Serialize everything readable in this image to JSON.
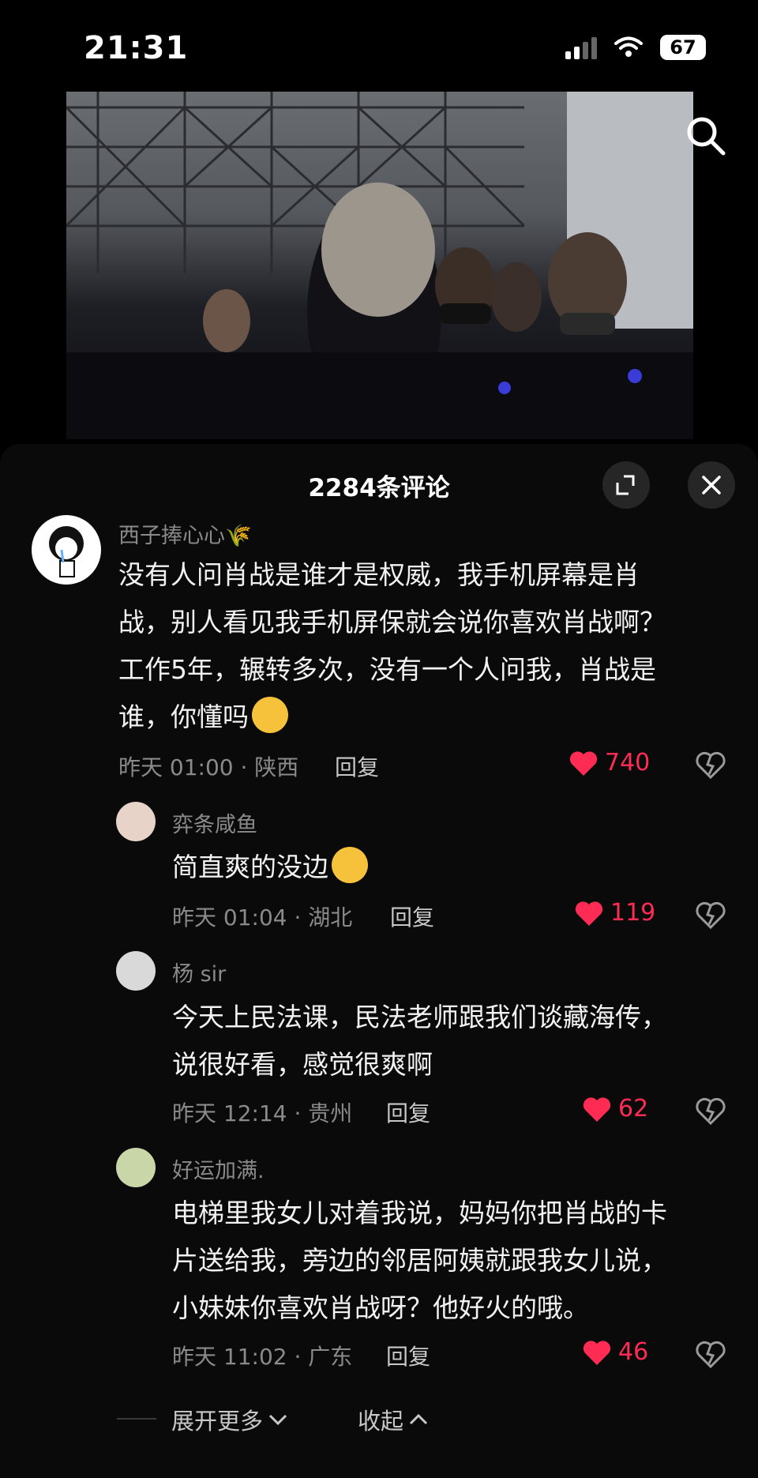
{
  "status_bar": {
    "time": "21:31",
    "battery": "67"
  },
  "comments_header": {
    "title": "2284条评论"
  },
  "comments": [
    {
      "username": "西子捧心心🌾",
      "text_lines": [
        "没有人问肖战是谁才是权威，我手机屏幕是肖",
        "战，别人看见我手机屏保就会说你喜欢肖战啊？",
        "工作5年，辗转多次，没有一个人问我，肖战是",
        "谁，你懂吗"
      ],
      "meta": "昨天 01:00 · 陕西",
      "reply_label": "回复",
      "likes": "740"
    },
    {
      "username": "弈条咸鱼",
      "text_lines": [
        "简直爽的没边"
      ],
      "meta": "昨天 01:04 · 湖北",
      "reply_label": "回复",
      "likes": "119"
    },
    {
      "username": "杨 sir",
      "text_lines": [
        "今天上民法课，民法老师跟我们谈藏海传，",
        "说很好看，感觉很爽啊"
      ],
      "meta": "昨天 12:14 · 贵州",
      "reply_label": "回复",
      "likes": "62"
    },
    {
      "username": "好运加满.",
      "text_lines": [
        "电梯里我女儿对着我说，妈妈你把肖战的卡",
        "片送给我，旁边的邻居阿姨就跟我女儿说，",
        "小妹妹你喜欢肖战呀？他好火的哦。"
      ],
      "meta": "昨天 11:02 · 广东",
      "reply_label": "回复",
      "likes": "46"
    }
  ],
  "footer": {
    "expand_label": "展开更多",
    "collapse_label": "收起"
  },
  "colors": {
    "like": "#fe2c55",
    "muted_text": "#8a8a8a",
    "sheet_bg": "#0a0a0a"
  }
}
